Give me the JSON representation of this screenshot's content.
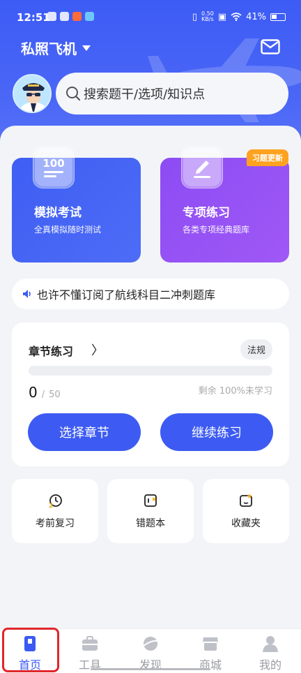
{
  "status": {
    "time": "12:51",
    "speed_top": "0.50",
    "speed_bottom": "KB/s",
    "battery": "41%"
  },
  "header": {
    "title": "私照飞机"
  },
  "search": {
    "placeholder": "搜索题干/选项/知识点"
  },
  "cards": [
    {
      "title": "模拟考试",
      "subtitle": "全真模拟随时测试",
      "icon": "exam-100-icon"
    },
    {
      "title": "专项练习",
      "subtitle": "各类专项经典题库",
      "icon": "pen-edit-icon",
      "badge": "习题更新"
    }
  ],
  "notice": {
    "text": "也许不懂订阅了航线科目二冲刺题库"
  },
  "chapter": {
    "title": "章节练习",
    "arrow": "〉",
    "tag": "法规",
    "done": "0",
    "separator": "/",
    "total": "50",
    "progress": 0,
    "remaining": "剩余 100%未学习",
    "select_label": "选择章节",
    "continue_label": "继续练习"
  },
  "quick": [
    {
      "label": "考前复习",
      "icon": "review-clock-icon"
    },
    {
      "label": "错题本",
      "icon": "wrong-book-icon"
    },
    {
      "label": "收藏夹",
      "icon": "favorites-icon"
    }
  ],
  "tabs": [
    {
      "label": "首页",
      "active": true
    },
    {
      "label": "工具",
      "active": false
    },
    {
      "label": "发现",
      "active": false
    },
    {
      "label": "商城",
      "active": false
    },
    {
      "label": "我的",
      "active": false
    }
  ],
  "colors": {
    "accent": "#3d5bf2",
    "purple": "#9a55f5",
    "badge": "#ffa21f",
    "highlight": "#e0262d"
  }
}
